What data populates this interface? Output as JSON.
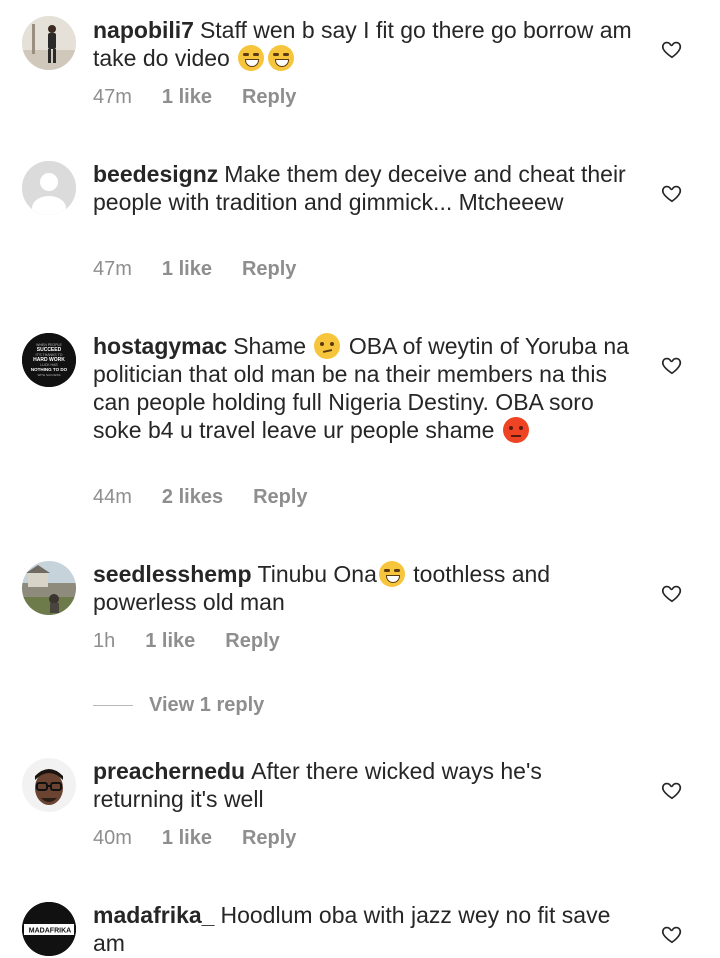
{
  "comments": [
    {
      "username": "napobili7",
      "text": "Staff wen b say I fit go there go borrow am take do video",
      "emoji": "😂😂",
      "time": "47m",
      "likes": "1 like",
      "reply": "Reply",
      "avatar": "person-standing-avatar"
    },
    {
      "username": "beedesignz",
      "text": "Make them dey deceive and cheat their people with tradition and gimmick... Mtcheeew",
      "time": "47m",
      "likes": "1 like",
      "reply": "Reply",
      "avatar": "default-avatar"
    },
    {
      "username": "hostagymac",
      "text_a": "Shame",
      "emoji_a": "😏",
      "text_b": "OBA of weytin of Yoruba na politician that old man be na their members na this can people holding full Nigeria Destiny. OBA soro soke b4 u travel leave ur people shame",
      "emoji_b": "😡",
      "time": "44m",
      "likes": "2 likes",
      "reply": "Reply",
      "avatar": "quote-avatar",
      "avatar_text": [
        "WHEN PEOPLE",
        "SUCCEED",
        "IT'S THANKS TO",
        "HARD WORK",
        "LUCK HAS",
        "NOTHING TO DO",
        "WITH SUCCESS"
      ]
    },
    {
      "username": "seedlesshemp",
      "text_a": "Tinubu Ona",
      "emoji_a": "😂",
      "text_b": "toothless and powerless old man",
      "time": "1h",
      "likes": "1 like",
      "reply": "Reply",
      "avatar": "outdoor-avatar"
    },
    {
      "username": "preachernedu",
      "text": "After there wicked ways he's returning it's well",
      "time": "40m",
      "likes": "1 like",
      "reply": "Reply",
      "avatar": "glasses-man-avatar"
    },
    {
      "username": "madafrika_",
      "text": "Hoodlum oba with jazz wey no fit save am",
      "avatar": "madafrika-logo-avatar",
      "avatar_text": "MADAFRIKA"
    }
  ],
  "view_replies": "View 1 reply",
  "icons": {
    "like": "heart-outline-icon"
  },
  "colors": {
    "text": "#262626",
    "secondary": "#8e8e8e"
  }
}
